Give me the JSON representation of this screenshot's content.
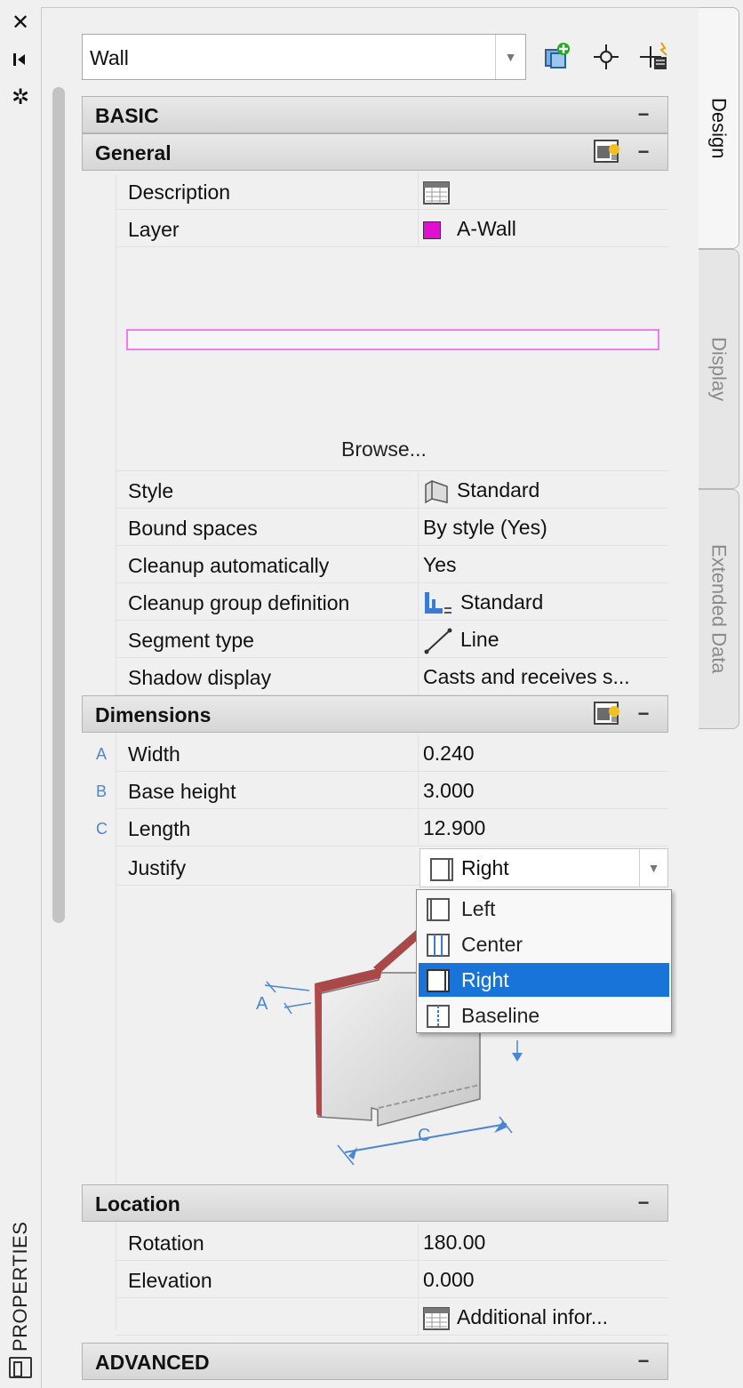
{
  "panel_title": "PROPERTIES",
  "object_type": {
    "value": "Wall"
  },
  "tabs": [
    {
      "label": "Design"
    },
    {
      "label": "Display"
    },
    {
      "label": "Extended Data"
    }
  ],
  "sections": {
    "basic": "BASIC",
    "general": "General",
    "dimensions": "Dimensions",
    "location": "Location",
    "advanced": "ADVANCED"
  },
  "general": {
    "description": {
      "name": "Description"
    },
    "layer": {
      "name": "Layer",
      "value": "A-Wall",
      "color": "#e010d0"
    },
    "browse": "Browse...",
    "style": {
      "name": "Style",
      "value": "Standard"
    },
    "bound_spaces": {
      "name": "Bound spaces",
      "value": "By style (Yes)"
    },
    "cleanup_auto": {
      "name": "Cleanup automatically",
      "value": "Yes"
    },
    "cleanup_group": {
      "name": "Cleanup group definition",
      "value": "Standard"
    },
    "segment_type": {
      "name": "Segment type",
      "value": "Line"
    },
    "shadow_display": {
      "name": "Shadow display",
      "value": "Casts and receives s..."
    }
  },
  "dimensions": {
    "width": {
      "letter": "A",
      "name": "Width",
      "value": "0.240"
    },
    "base_height": {
      "letter": "B",
      "name": "Base height",
      "value": "3.000"
    },
    "length": {
      "letter": "C",
      "name": "Length",
      "value": "12.900"
    },
    "justify": {
      "name": "Justify",
      "value": "Right"
    },
    "justify_options": [
      "Left",
      "Center",
      "Right",
      "Baseline"
    ],
    "diagram_labels": {
      "a": "A",
      "c": "C"
    }
  },
  "location": {
    "rotation": {
      "name": "Rotation",
      "value": "180.00"
    },
    "elevation": {
      "name": "Elevation",
      "value": "0.000"
    },
    "additional": {
      "value": "Additional infor..."
    }
  },
  "colors": {
    "accent": "#1874d8",
    "layer_preview": "#f07cf0",
    "dimension_letters": "#4a86d4"
  }
}
